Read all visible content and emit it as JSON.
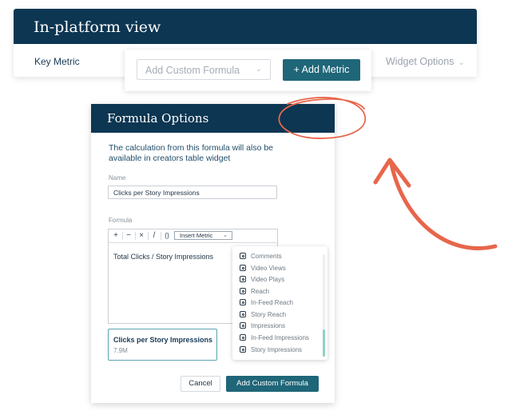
{
  "top": {
    "title": "In-platform view",
    "key_metric_label": "Key Metric",
    "widget_options_label": "Widget Options",
    "formula_select_placeholder": "Add Custom Formula",
    "add_metric_label": "+ Add Metric"
  },
  "modal": {
    "title": "Formula Options",
    "intro": "The calculation from this formula will also be available in creators table widget",
    "name_label": "Name",
    "name_value": "Clicks per Story Impressions",
    "formula_label": "Formula",
    "toolbar": {
      "plus": "+",
      "minus": "−",
      "times": "×",
      "divide": "/",
      "braces": "{}",
      "insert_metric": "Insert Metric"
    },
    "formula_text": "Total Clicks / Story Impressions",
    "preview": {
      "name": "Clicks per Story Impressions",
      "value": "7.9M"
    },
    "cancel_label": "Cancel",
    "add_label": "Add Custom Formula"
  },
  "dropdown": {
    "icon": "instagram-icon",
    "items": [
      "Comments",
      "Video Views",
      "Video Plays",
      "Reach",
      "In-Feed Reach",
      "Story Reach",
      "Impressions",
      "In-Feed Impressions",
      "Story Impressions"
    ]
  },
  "colors": {
    "header": "#0c3652",
    "button": "#1f6678",
    "annotation": "#e8664b",
    "scroll_thumb": "#8fd1c4"
  }
}
